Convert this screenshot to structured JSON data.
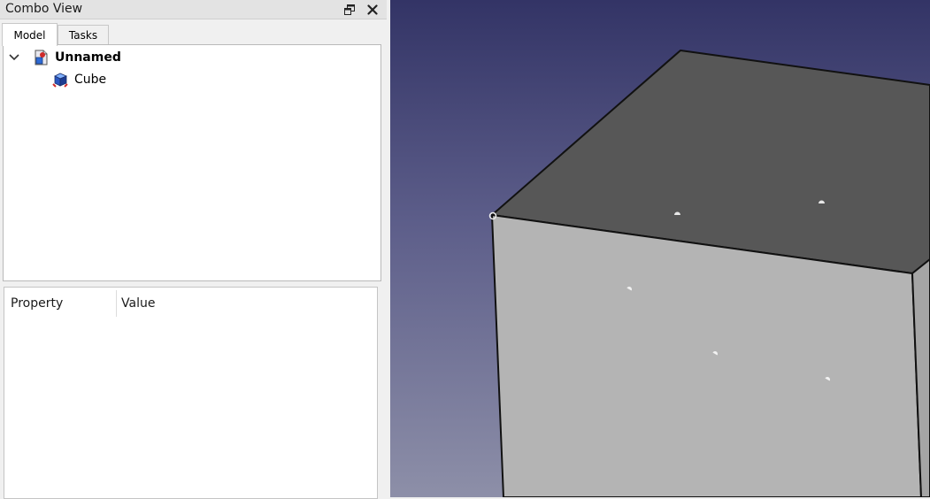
{
  "combo_view": {
    "title": "Combo View",
    "float_icon": "float-window-icon",
    "close_icon": "close-icon",
    "tabs": [
      {
        "label": "Model",
        "active": true
      },
      {
        "label": "Tasks",
        "active": false
      }
    ]
  },
  "tree": {
    "root": {
      "label": "Unnamed",
      "expanded": true,
      "icon": "document-icon"
    },
    "children": [
      {
        "label": "Cube",
        "icon": "cube-icon"
      }
    ]
  },
  "property_view": {
    "columns": [
      "Property",
      "Value"
    ]
  },
  "viewport": {
    "background_top": "#333466",
    "background_bottom": "#8d8fa8",
    "top_face_color": "#575757",
    "side_face_color": "#b4b4b4",
    "edge_color": "#111111"
  }
}
